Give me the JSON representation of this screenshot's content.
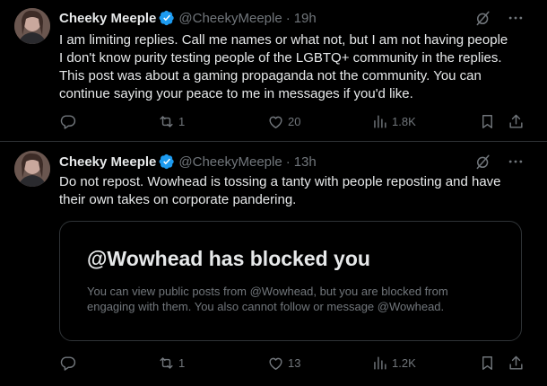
{
  "tweets": [
    {
      "author": {
        "name": "Cheeky Meeple",
        "handle": "@CheekyMeeple"
      },
      "time": "19h",
      "lines": [
        "I am limiting replies. Call me names or what not, but I am not having people",
        "I don't know purity testing people of the LGBTQ+ community in the replies.",
        "This post was about a gaming propaganda not the community. You can",
        "continue saying your peace to me in messages if you'd like."
      ],
      "stats": {
        "reposts": "1",
        "likes": "20",
        "views": "1.8K"
      }
    },
    {
      "author": {
        "name": "Cheeky Meeple",
        "handle": "@CheekyMeeple"
      },
      "time": "13h",
      "lines": [
        "Do not repost. Wowhead is tossing a tanty with people reposting and have",
        "their own takes on corporate pandering."
      ],
      "card": {
        "title": "@Wowhead has blocked you",
        "lines": [
          "You can view public posts from @Wowhead, but you are blocked from",
          "engaging with them. You also cannot follow or message @Wowhead."
        ]
      },
      "stats": {
        "reposts": "1",
        "likes": "13",
        "views": "1.2K"
      }
    }
  ],
  "separator": "·",
  "colors": {
    "background": "#000000",
    "text": "#e7e9ea",
    "muted": "#71767b",
    "verified": "#1d9bf0",
    "border": "#2f3336"
  }
}
